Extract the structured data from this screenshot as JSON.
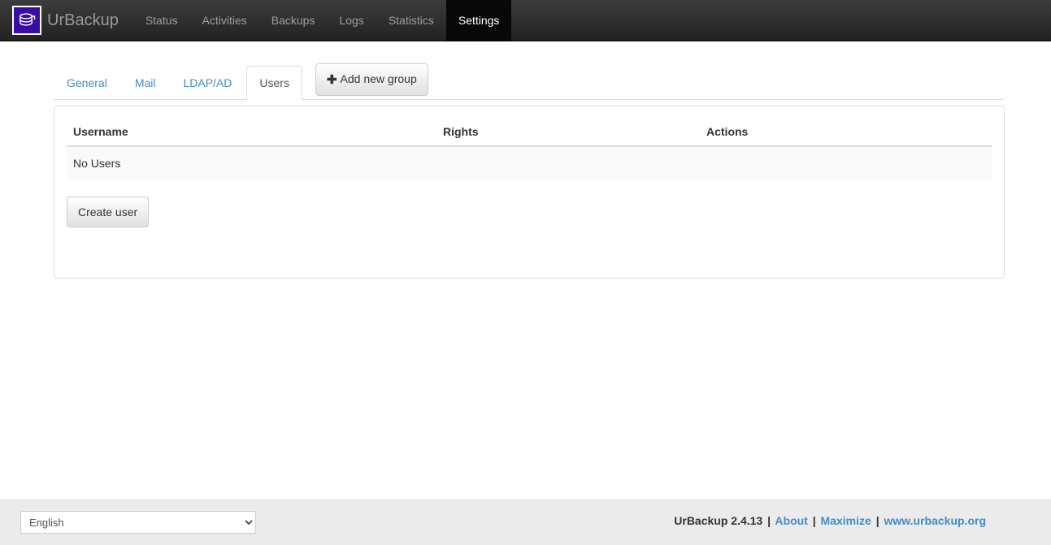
{
  "navbar": {
    "brand": {
      "text": "UrBackup",
      "logo_icon": "database-cylinder-icon",
      "logo_color": "#3a0ca3"
    },
    "items": [
      {
        "label": "Status",
        "active": false
      },
      {
        "label": "Activities",
        "active": false
      },
      {
        "label": "Backups",
        "active": false
      },
      {
        "label": "Logs",
        "active": false
      },
      {
        "label": "Statistics",
        "active": false
      },
      {
        "label": "Settings",
        "active": true
      }
    ]
  },
  "tabs": {
    "items": [
      {
        "label": "General",
        "active": false
      },
      {
        "label": "Mail",
        "active": false
      },
      {
        "label": "LDAP/AD",
        "active": false
      },
      {
        "label": "Users",
        "active": true
      }
    ],
    "add_group_button": {
      "label": "Add new group",
      "icon": "plus-icon"
    }
  },
  "users_panel": {
    "columns": [
      "Username",
      "Rights",
      "Actions"
    ],
    "rows": [
      {
        "username": "No Users",
        "rights": "",
        "actions": ""
      }
    ],
    "create_user_button": "Create user"
  },
  "footer": {
    "language": {
      "selected": "English",
      "options": [
        "English"
      ]
    },
    "version": "UrBackup 2.4.13",
    "sep": "|",
    "links": [
      {
        "label": "About"
      },
      {
        "label": "Maximize"
      },
      {
        "label": "www.urbackup.org"
      }
    ]
  },
  "colors": {
    "navbar_top": "#3c3c3c",
    "navbar_bottom": "#222222",
    "navbar_active": "#080808",
    "link": "#428bca",
    "panel_border": "#dddddd",
    "row_bg": "#f9f9f9",
    "footer_bg": "#ebebeb"
  }
}
